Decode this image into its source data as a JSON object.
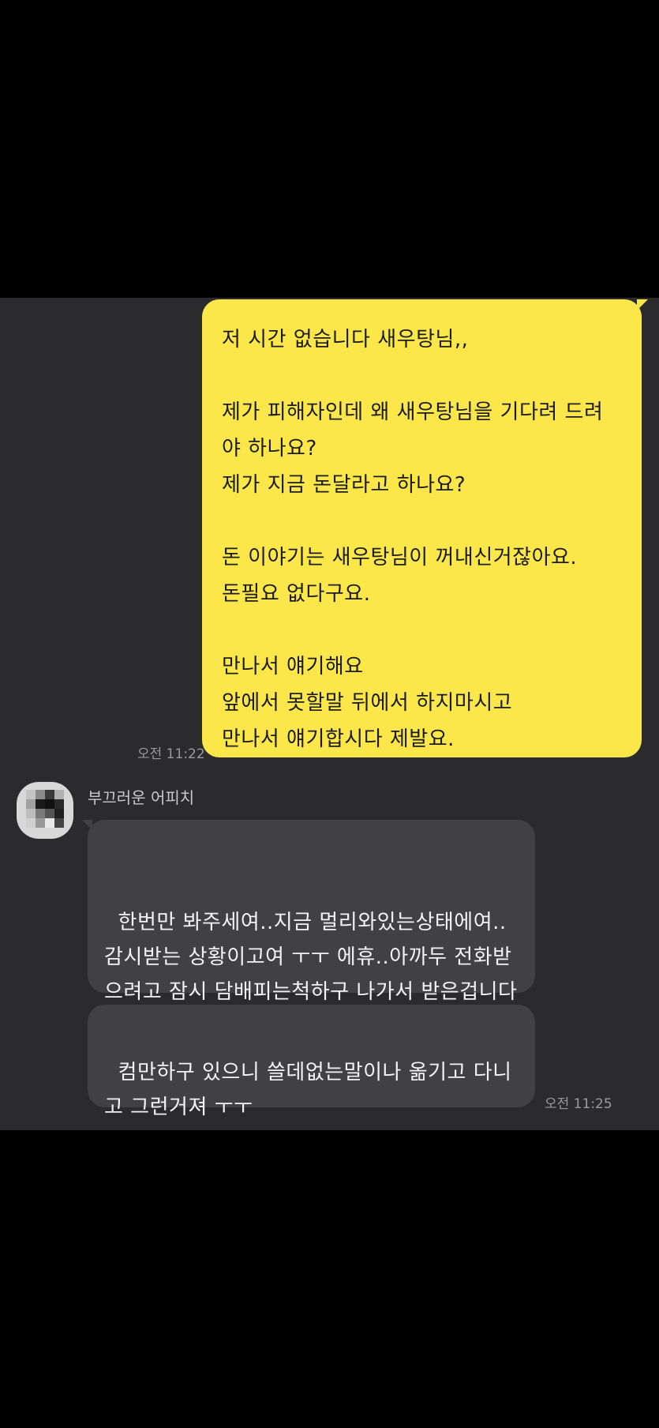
{
  "chat": {
    "sent_message": {
      "text": "저 시간 없습니다 새우탕님,,\n\n제가 피해자인데 왜 새우탕님을 기다려 드려야 하나요?\n제가 지금 돈달라고 하나요?\n\n돈 이야기는 새우탕님이 꺼내신거잖아요.\n돈필요 없다구요.\n\n만나서 얘기해요\n앞에서 못할말 뒤에서 하지마시고\n만나서 얘기합시다 제발요.",
      "time": "오전 11:22"
    },
    "sender": {
      "name": "부끄러운 어피치"
    },
    "received_messages": [
      {
        "text": "한번만 봐주세여..지금 멀리와있는상태에여..감시받는 상황이고여 ㅜㅜ 에휴..아까두 전화받으려고 잠시 담배피는척하구 나가서 받은겁니다 ㅜㅜ 제발 사정좀 봐주세요"
      },
      {
        "text": "컴만하구 있으니 쓸데없는말이나 옮기고 다니고 그런거져 ㅜㅜ"
      }
    ],
    "received_time": "오전 11:25"
  }
}
